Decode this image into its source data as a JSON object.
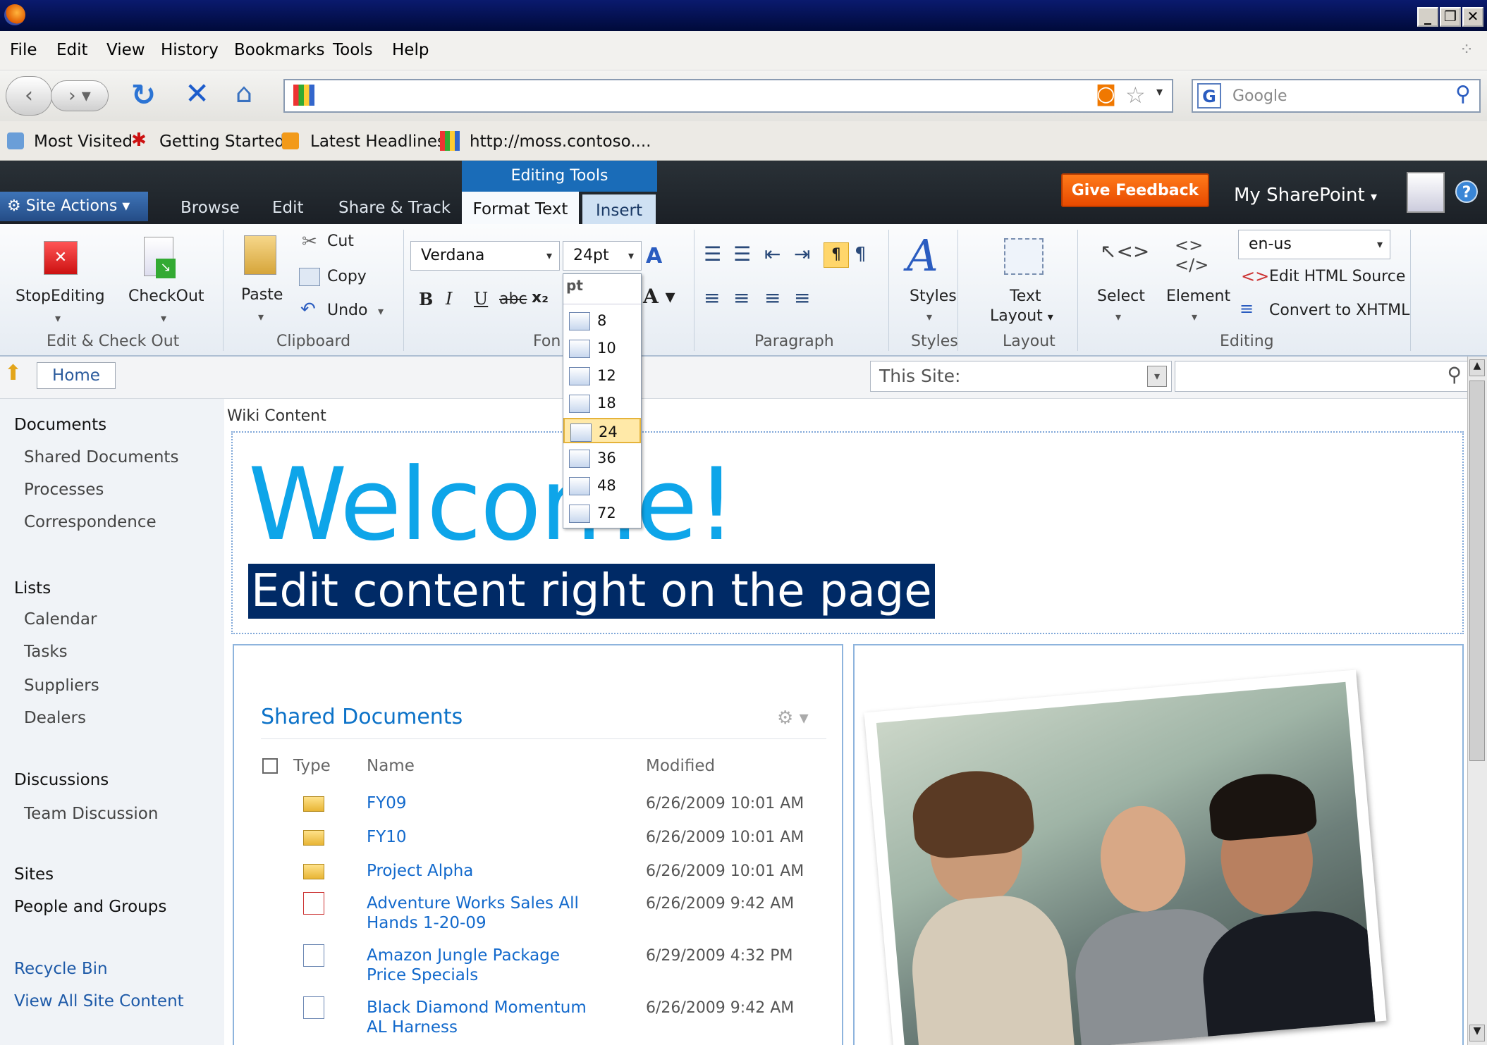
{
  "menubar": {
    "items": [
      "File",
      "Edit",
      "View",
      "History",
      "Bookmarks",
      "Tools",
      "Help"
    ]
  },
  "navbar": {
    "search_placeholder": "Google",
    "url": ""
  },
  "bookmarks": {
    "items": [
      "Most Visited",
      "Getting Started",
      "Latest Headlines",
      "http://moss.contoso...."
    ]
  },
  "ribbon": {
    "context_group": "Editing Tools",
    "site_actions": "Site Actions",
    "tabs": [
      "Browse",
      "Edit",
      "Share & Track",
      "Format Text",
      "Insert"
    ],
    "feedback": "Give Feedback",
    "my_sharepoint": "My SharePoint",
    "groups": [
      "Edit & Check Out",
      "Clipboard",
      "Fon",
      "Paragraph",
      "Styles",
      "Layout",
      "Editing"
    ],
    "stop_editing": "StopEditing",
    "check_out": "CheckOut",
    "paste": "Paste",
    "cut": "Cut",
    "copy": "Copy",
    "undo": "Undo",
    "font_family": "Verdana",
    "font_size": "24pt",
    "styles": "Styles",
    "text_layout_1": "Text",
    "text_layout_2": "Layout",
    "select": "Select",
    "element": "Element",
    "language": "en-us",
    "edit_html": "Edit HTML Source",
    "convert_xhtml": "Convert to XHTML"
  },
  "font_size_menu": {
    "header": "pt",
    "sizes": [
      "8",
      "10",
      "12",
      "18",
      "24",
      "36",
      "48",
      "72"
    ],
    "selected": "24"
  },
  "breadcrumb": {
    "home": "Home",
    "scope": "This Site:"
  },
  "leftnav": {
    "documents": "Documents",
    "doc_items": [
      "Shared Documents",
      "Processes",
      "Correspondence"
    ],
    "lists": "Lists",
    "list_items": [
      "Calendar",
      "Tasks",
      "Suppliers",
      "Dealers"
    ],
    "discussions": "Discussions",
    "discussion_items": [
      "Team Discussion"
    ],
    "sites": "Sites",
    "people": "People and Groups",
    "recycle": "Recycle Bin",
    "view_all": "View All Site Content"
  },
  "main": {
    "wiki_label": "Wiki Content",
    "welcome": "Welcome!",
    "subtitle": "Edit content right on the page",
    "doc_title": "Shared Documents",
    "columns": [
      "Type",
      "Name",
      "Modified"
    ],
    "rows": [
      {
        "type": "folder",
        "name": "FY09",
        "modified": "6/26/2009 10:01 AM"
      },
      {
        "type": "folder",
        "name": "FY10",
        "modified": "6/26/2009 10:01 AM"
      },
      {
        "type": "folder",
        "name": "Project Alpha",
        "modified": "6/26/2009 10:01 AM"
      },
      {
        "type": "ppt",
        "name_l1": "Adventure Works Sales All",
        "name_l2": "Hands 1-20-09",
        "modified": "6/26/2009 9:42 AM"
      },
      {
        "type": "doc",
        "name_l1": "Amazon Jungle Package",
        "name_l2": "Price Specials",
        "modified": "6/29/2009 4:32 PM"
      },
      {
        "type": "doc",
        "name_l1": "Black Diamond Momentum",
        "name_l2": "AL Harness",
        "modified": "6/26/2009 9:42 AM"
      }
    ]
  }
}
